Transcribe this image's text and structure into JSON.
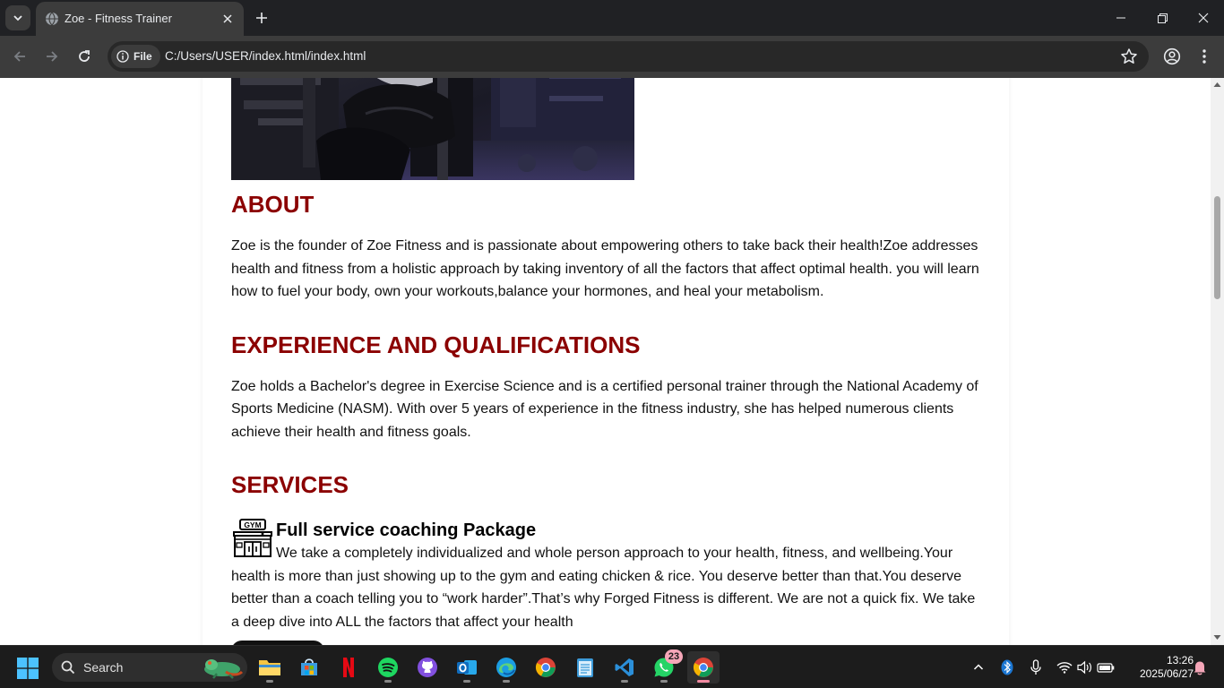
{
  "browser": {
    "tab_title": "Zoe - Fitness Trainer",
    "file_chip_label": "File",
    "url": "C:/Users/USER/index.html/index.html"
  },
  "page": {
    "about": {
      "heading": "ABOUT",
      "text": "Zoe is the founder of Zoe Fitness and is passionate about empowering others to take back their health!Zoe addresses health and fitness from a holistic approach by taking inventory of all the factors that affect optimal health. you will learn how to fuel your body, own your workouts,balance your hormones, and heal your metabolism."
    },
    "experience": {
      "heading": "EXPERIENCE AND QUALIFICATIONS",
      "text": "Zoe holds a Bachelor's degree in Exercise Science and is a certified personal trainer through the National Academy of Sports Medicine (NASM). With over 5 years of experience in the fitness industry, she has helped numerous clients achieve their health and fitness goals."
    },
    "services": {
      "heading": "SERVICES",
      "items": [
        {
          "icon": "gym-icon",
          "title": "Full service coaching Package",
          "description": "We take a completely individualized and whole person approach to your health, fitness, and wellbeing.Your health is more than just showing up to the gym and eating chicken & rice. You deserve better than that.You deserve better than a coach telling you to “work harder”.That’s why Forged Fitness is different. We are not a quick fix. We take a deep dive into ALL the factors that affect your health"
        }
      ]
    }
  },
  "taskbar": {
    "search_label": "Search",
    "whatsapp_badge": "23",
    "clock_time": "13:26",
    "clock_date": "2025/06/27"
  },
  "colors": {
    "heading": "#8b0000",
    "browser_frame": "#202124",
    "toolbar": "#3c3c3c",
    "taskbar": "#1c1c1c"
  }
}
